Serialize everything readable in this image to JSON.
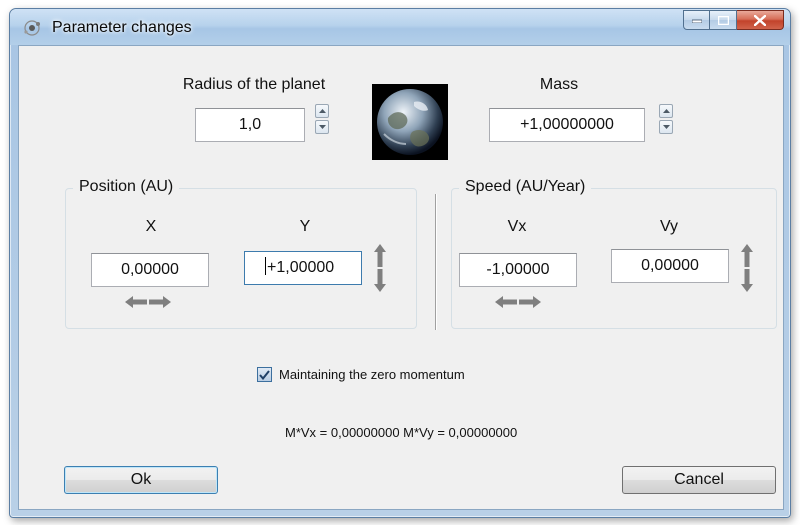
{
  "window": {
    "title": "Parameter changes",
    "icon": "app-icon",
    "controls": {
      "minimize": "minimize-icon",
      "maximize": "maximize-icon",
      "close": "close-icon"
    }
  },
  "planet": {
    "radius_label": "Radius of the planet",
    "radius_value": "1,0",
    "mass_label": "Mass",
    "mass_value": "+1,00000000",
    "image_icon": "earth-globe-icon"
  },
  "position": {
    "group_title": "Position (AU)",
    "x_label": "X",
    "x_value": "0,00000",
    "y_label": "Y",
    "y_value": "+1,00000"
  },
  "speed": {
    "group_title": "Speed (AU/Year)",
    "vx_label": "Vx",
    "vx_value": "-1,00000",
    "vy_label": "Vy",
    "vy_value": "0,00000"
  },
  "momentum": {
    "checkbox_label": "Maintaining the zero momentum",
    "checked": true,
    "formula": "M*Vx = 0,00000000 M*Vy = 0,00000000"
  },
  "buttons": {
    "ok": "Ok",
    "cancel": "Cancel"
  },
  "colors": {
    "accent": "#3c7fb1",
    "close": "#c2432b",
    "arrow": "#7f7f7f"
  }
}
